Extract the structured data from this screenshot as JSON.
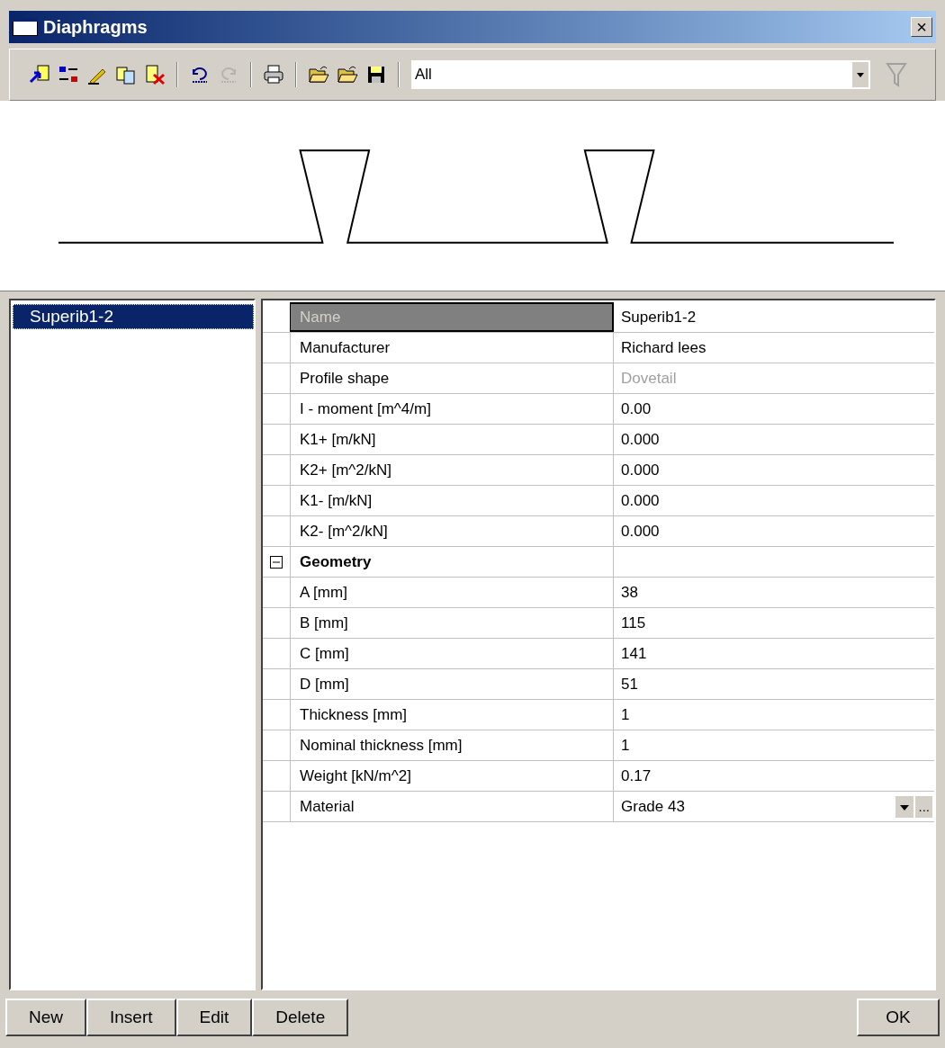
{
  "window": {
    "title": "Diaphragms",
    "close": "×"
  },
  "toolbar": {
    "buttons": [
      {
        "kind": "import",
        "disabled": false
      },
      {
        "kind": "swap",
        "disabled": false
      },
      {
        "kind": "pencil",
        "disabled": false
      },
      {
        "kind": "copy",
        "disabled": false
      },
      {
        "kind": "delete",
        "disabled": false
      },
      {
        "kind": "separator"
      },
      {
        "kind": "undo",
        "disabled": false
      },
      {
        "kind": "redo",
        "disabled": true
      },
      {
        "kind": "separator"
      },
      {
        "kind": "print",
        "disabled": false
      },
      {
        "kind": "separator"
      },
      {
        "kind": "open",
        "disabled": false
      },
      {
        "kind": "open",
        "disabled": false
      },
      {
        "kind": "save",
        "disabled": false
      },
      {
        "kind": "separator"
      }
    ],
    "filter_combo": {
      "value": "All"
    },
    "filter_disabled": true
  },
  "list": {
    "items": [
      {
        "label": "Superib1-2",
        "selected": true
      }
    ]
  },
  "properties": [
    {
      "kind": "property",
      "label": "Name",
      "value": "Superib1-2",
      "selected": true,
      "disabled": false
    },
    {
      "kind": "property",
      "label": "Manufacturer",
      "value": "Richard lees",
      "selected": false,
      "disabled": false
    },
    {
      "kind": "property",
      "label": "Profile shape",
      "value": "Dovetail",
      "selected": false,
      "disabled": true
    },
    {
      "kind": "property",
      "label": "I - moment [m^4/m]",
      "value": "0.00",
      "selected": false,
      "disabled": false
    },
    {
      "kind": "property",
      "label": "K1+ [m/kN]",
      "value": "0.000",
      "selected": false,
      "disabled": false
    },
    {
      "kind": "property",
      "label": "K2+ [m^2/kN]",
      "value": "0.000",
      "selected": false,
      "disabled": false
    },
    {
      "kind": "property",
      "label": "K1- [m/kN]",
      "value": "0.000",
      "selected": false,
      "disabled": false
    },
    {
      "kind": "property",
      "label": "K2- [m^2/kN]",
      "value": "0.000",
      "selected": false,
      "disabled": false
    },
    {
      "kind": "category",
      "label": "Geometry",
      "expanded": true
    },
    {
      "kind": "property",
      "label": "A [mm]",
      "value": "38",
      "selected": false,
      "disabled": false
    },
    {
      "kind": "property",
      "label": "B [mm]",
      "value": "115",
      "selected": false,
      "disabled": false
    },
    {
      "kind": "property",
      "label": "C [mm]",
      "value": "141",
      "selected": false,
      "disabled": false
    },
    {
      "kind": "property",
      "label": "D [mm]",
      "value": "51",
      "selected": false,
      "disabled": false
    },
    {
      "kind": "property",
      "label": "Thickness [mm]",
      "value": "1",
      "selected": false,
      "disabled": false
    },
    {
      "kind": "property",
      "label": "Nominal thickness [mm]",
      "value": "1",
      "selected": false,
      "disabled": false
    },
    {
      "kind": "property",
      "label": "Weight [kN/m^2]",
      "value": "0.17",
      "selected": false,
      "disabled": false
    },
    {
      "kind": "dropdown",
      "label": "Material",
      "value": "Grade 43",
      "selected": false,
      "disabled": false,
      "more": "..."
    }
  ],
  "buttons_left": [
    "New",
    "Insert",
    "Edit",
    "Delete"
  ],
  "buttons_right": [
    "OK"
  ]
}
